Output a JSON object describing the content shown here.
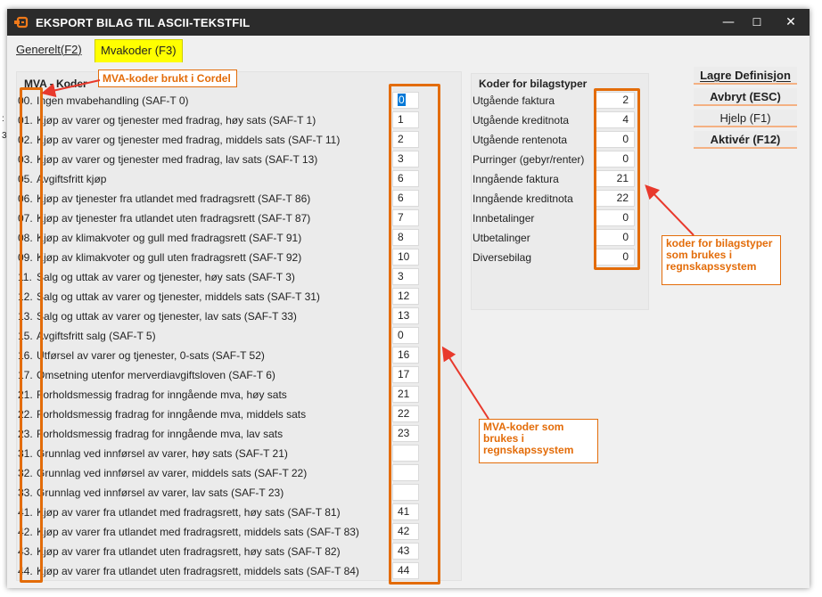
{
  "window": {
    "title": "EKSPORT BILAG TIL ASCII-TEKSTFIL",
    "minimize_glyph": "—",
    "maximize_glyph": "☐",
    "close_glyph": "✕"
  },
  "tabs": [
    {
      "label": "Generelt(F2)",
      "active": false
    },
    {
      "label": "Mvakoder (F3)",
      "active": true
    }
  ],
  "mva_group": {
    "title": "MVA - Koder",
    "rows": [
      {
        "code": "00.",
        "label": "Ingen mvabehandling (SAF-T 0)",
        "value": "0"
      },
      {
        "code": "01.",
        "label": "Kjøp av varer og tjenester med fradrag, høy sats (SAF-T 1)",
        "value": "1"
      },
      {
        "code": "02.",
        "label": "Kjøp av varer og tjenester med fradrag, middels sats (SAF-T 11)",
        "value": "2"
      },
      {
        "code": "03.",
        "label": "Kjøp av varer og tjenester med fradrag, lav sats (SAF-T 13)",
        "value": "3"
      },
      {
        "code": "05.",
        "label": "Avgiftsfritt kjøp",
        "value": "6"
      },
      {
        "code": "06.",
        "label": "Kjøp av tjenester fra utlandet med fradragsrett (SAF-T 86)",
        "value": "6"
      },
      {
        "code": "07.",
        "label": "Kjøp av tjenester fra utlandet uten fradragsrett (SAF-T 87)",
        "value": "7"
      },
      {
        "code": "08.",
        "label": "Kjøp av klimakvoter og gull med fradragsrett (SAF-T 91)",
        "value": "8"
      },
      {
        "code": "09.",
        "label": "Kjøp av klimakvoter og gull uten fradragsrett (SAF-T 92)",
        "value": "10"
      },
      {
        "code": "11.",
        "label": "Salg og uttak av varer og tjenester, høy sats (SAF-T 3)",
        "value": "3"
      },
      {
        "code": "12.",
        "label": "Salg og uttak av varer og tjenester, middels sats (SAF-T 31)",
        "value": "12"
      },
      {
        "code": "13.",
        "label": "Salg og uttak av varer og tjenester, lav sats (SAF-T 33)",
        "value": "13"
      },
      {
        "code": "15.",
        "label": "Avgiftsfritt salg (SAF-T 5)",
        "value": "0"
      },
      {
        "code": "16.",
        "label": "Utførsel av varer og tjenester, 0-sats (SAF-T 52)",
        "value": "16"
      },
      {
        "code": "17.",
        "label": "Omsetning utenfor merverdiavgiftsloven (SAF-T 6)",
        "value": "17"
      },
      {
        "code": "21.",
        "label": "Forholdsmessig fradrag for inngående mva, høy sats",
        "value": "21"
      },
      {
        "code": "22.",
        "label": "Forholdsmessig fradrag for inngående mva, middels sats",
        "value": "22"
      },
      {
        "code": "23.",
        "label": "Forholdsmessig fradrag for inngående mva, lav sats",
        "value": "23"
      },
      {
        "code": "31.",
        "label": "Grunnlag ved innførsel av varer, høy sats (SAF-T 21)",
        "value": ""
      },
      {
        "code": "32.",
        "label": "Grunnlag ved innførsel av varer, middels sats (SAF-T 22)",
        "value": ""
      },
      {
        "code": "33.",
        "label": "Grunnlag ved innførsel av varer, lav sats (SAF-T 23)",
        "value": ""
      },
      {
        "code": "41.",
        "label": "Kjøp av varer fra utlandet med fradragsrett, høy sats (SAF-T 81)",
        "value": "41"
      },
      {
        "code": "42.",
        "label": "Kjøp av varer fra utlandet med fradragsrett, middels sats (SAF-T 83)",
        "value": "42"
      },
      {
        "code": "43.",
        "label": "Kjøp av varer fra utlandet uten fradragsrett, høy sats (SAF-T 82)",
        "value": "43"
      },
      {
        "code": "44.",
        "label": "Kjøp av varer fra utlandet uten fradragsrett, middels sats (SAF-T 84)",
        "value": "44"
      }
    ]
  },
  "bilag_group": {
    "title": "Koder for bilagstyper",
    "rows": [
      {
        "label": "Utgående faktura",
        "value": "2"
      },
      {
        "label": "Utgående kreditnota",
        "value": "4"
      },
      {
        "label": "Utgående rentenota",
        "value": "0"
      },
      {
        "label": "Purringer (gebyr/renter)",
        "value": "0"
      },
      {
        "label": "Inngående faktura",
        "value": "21"
      },
      {
        "label": "Inngående kreditnota",
        "value": "22"
      },
      {
        "label": "Innbetalinger",
        "value": "0"
      },
      {
        "label": "Utbetalinger",
        "value": "0"
      },
      {
        "label": "Diversebilag",
        "value": "0"
      }
    ]
  },
  "buttons": {
    "save": "Lagre Definisjon",
    "cancel": "Avbryt (ESC)",
    "help": "Hjelp (F1)",
    "activate": "Aktivér (F12)"
  },
  "annotations": {
    "mva_codes_cordel": "MVA-koder brukt i Cordel",
    "bilag_codes": "koder for bilagstyper som brukes i regnskapssystem",
    "mva_codes_regnskap": "MVA-koder som brukes i regnskapssystem",
    "color": "#e36c09"
  },
  "colors": {
    "titlebar": "#2b2b2b",
    "active_tab": "#ffff00",
    "button_underline": "#f4b183",
    "selection": "#0078d7"
  }
}
